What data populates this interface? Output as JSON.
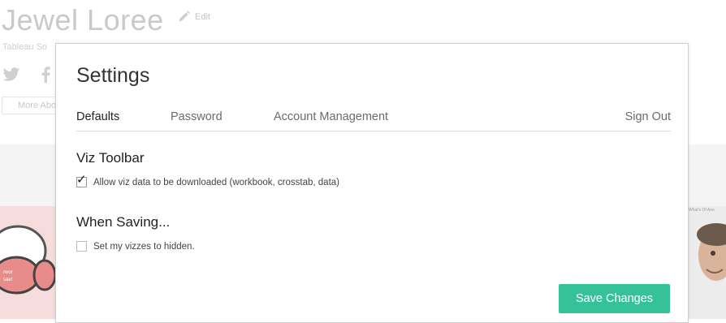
{
  "profile": {
    "name": "Jewel Loree",
    "edit_label": "Edit",
    "subtitle": "Tableau So",
    "more_about_label": "More Abo"
  },
  "thumbnails": {
    "right_title": "What's Of Ano"
  },
  "settings": {
    "title": "Settings",
    "tabs": [
      {
        "label": "Defaults",
        "active": true
      },
      {
        "label": "Password",
        "active": false
      },
      {
        "label": "Account Management",
        "active": false
      },
      {
        "label": "Sign Out",
        "active": false
      }
    ],
    "viz_toolbar": {
      "heading": "Viz Toolbar",
      "allow_download_label": "Allow viz data to be downloaded (workbook, crosstab, data)",
      "allow_download_checked": true
    },
    "when_saving": {
      "heading": "When Saving...",
      "hidden_label": "Set my vizzes to hidden.",
      "hidden_checked": false
    },
    "save_label": "Save Changes"
  },
  "colors": {
    "accent": "#36c298",
    "background_text": "#c9c9c9",
    "thumbnail_pink": "#f6dcdc"
  },
  "icons": {
    "edit": "pencil-icon",
    "twitter": "twitter-icon",
    "facebook": "facebook-icon",
    "checkbox_checked": "checkmark-icon"
  }
}
